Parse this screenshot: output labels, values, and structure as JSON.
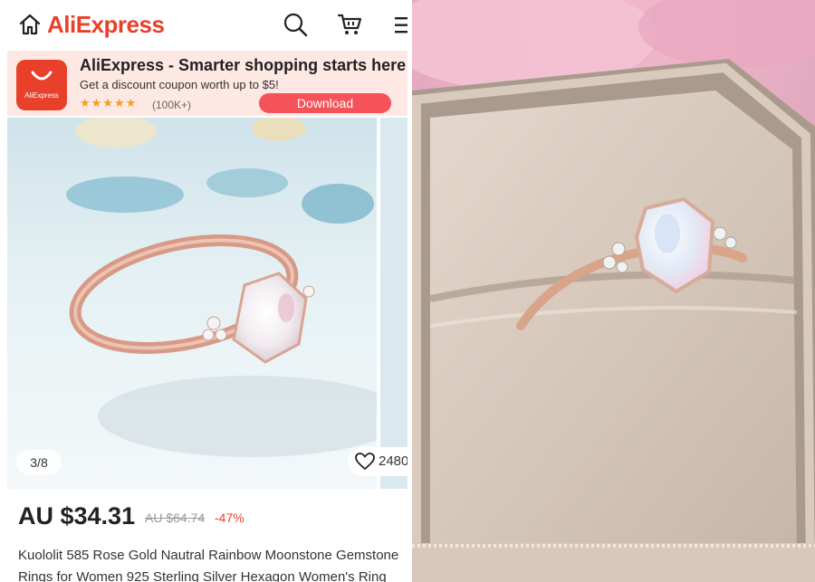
{
  "header": {
    "brand": "AliExpress",
    "icons": [
      "home-icon",
      "search-icon",
      "cart-icon",
      "menu-icon"
    ]
  },
  "banner": {
    "logo_text": "AliExpress",
    "title": "AliExpress - Smarter shopping starts here",
    "subtitle": "Get a discount coupon worth up to $5!",
    "rating_stars": 5,
    "rating_count": "(100K+)",
    "download_label": "Download"
  },
  "gallery": {
    "counter": "3/8",
    "wish_count": "2480"
  },
  "product": {
    "price": "AU $34.31",
    "original_price": "AU $64.74",
    "discount": "-47%",
    "title_line1": "Kuololit 585 Rose Gold Nautral Rainbow Moonstone Gemstone",
    "title_line2": "Rings for Women 925 Sterling Silver Hexagon Women's Ring"
  },
  "colors": {
    "brand": "#e8402a",
    "banner_bg": "#fde8e3",
    "download_btn": "#f5525a",
    "star": "#f0a020"
  }
}
